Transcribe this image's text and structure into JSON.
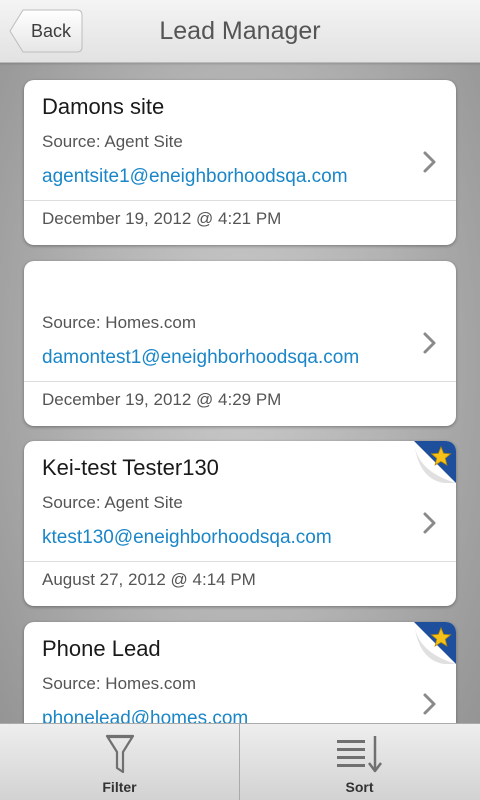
{
  "header": {
    "back_label": "Back",
    "title": "Lead Manager"
  },
  "leads": [
    {
      "name": "Damons site",
      "source": "Source: Agent Site",
      "email": "agentsite1@eneighborhoodsqa.com",
      "date": "December 19, 2012 @ 4:21  PM",
      "starred": false
    },
    {
      "name": "",
      "source": "Source: Homes.com",
      "email": "damontest1@eneighborhoodsqa.com",
      "date": "December 19, 2012 @ 4:29  PM",
      "starred": false
    },
    {
      "name": "Kei-test Tester130",
      "source": "Source: Agent Site",
      "email": "ktest130@eneighborhoodsqa.com",
      "date": "August 27, 2012 @ 4:14  PM",
      "starred": true
    },
    {
      "name": "Phone Lead",
      "source": "Source: Homes.com",
      "email": "phonelead@homes.com",
      "date": "",
      "starred": true
    }
  ],
  "toolbar": {
    "filter_label": "Filter",
    "sort_label": "Sort"
  },
  "colors": {
    "email_link": "#1a86c8",
    "star_flag": "#1e4f9c",
    "star": "#f6c21a"
  }
}
